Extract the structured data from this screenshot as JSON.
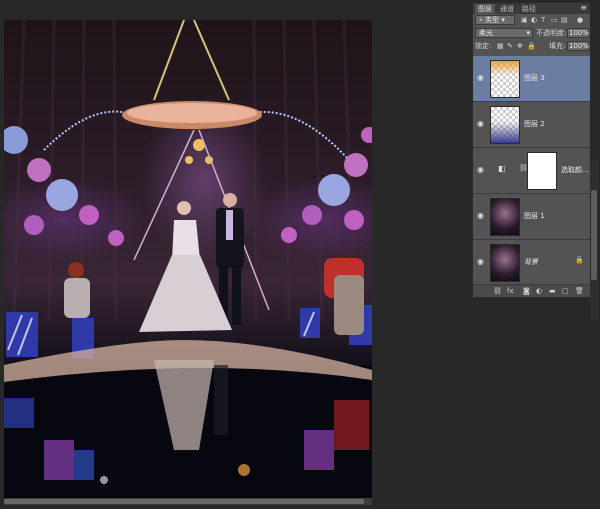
{
  "panel": {
    "tabs": [
      "图层",
      "通道",
      "路径"
    ],
    "filter_label": "类型",
    "blend_mode": "柔光",
    "opacity_label": "不透明度:",
    "opacity_value": "100%",
    "lock_label": "锁定:",
    "fill_label": "填充:",
    "fill_value": "100%",
    "menu_icon": "menu-icon",
    "layers": [
      {
        "name": "图层 3",
        "selected": true
      },
      {
        "name": "图层 2",
        "selected": false
      },
      {
        "name": "选取颜...",
        "selected": false
      },
      {
        "name": "图层 1",
        "selected": false
      },
      {
        "name": "背景",
        "selected": false
      }
    ],
    "bottom_icons": [
      "link-icon",
      "fx-icon",
      "mask-icon",
      "adjustment-icon",
      "group-icon",
      "new-layer-icon",
      "trash-icon"
    ]
  },
  "colors": {
    "panel_bg": "#535353",
    "selected_layer": "#6b7da0",
    "workspace": "#282828"
  }
}
